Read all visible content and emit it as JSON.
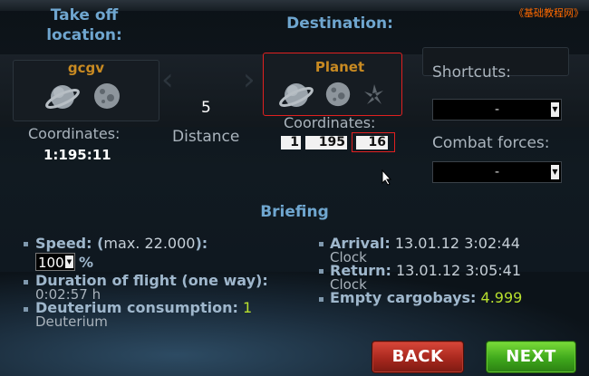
{
  "watermark": "《基础教程网》",
  "origin": {
    "heading_line1": "Take off",
    "heading_line2": "location:",
    "planet_name": "gcgv",
    "coords_label": "Coordinates:",
    "coords_value": "1:195:11"
  },
  "distance": {
    "value": "5",
    "label": "Distance"
  },
  "destination": {
    "heading": "Destination:",
    "planet_name": "Planet",
    "coords_label": "Coordinates:",
    "galaxy": "1",
    "system": "195",
    "position": "16"
  },
  "shortcuts": {
    "label": "Shortcuts:",
    "selected": "-"
  },
  "combat_forces": {
    "label": "Combat forces:",
    "selected": "-"
  },
  "briefing": {
    "heading": "Briefing",
    "speed_label": "Speed: (",
    "speed_max": "max. 22.000",
    "speed_label_end": "):",
    "speed_value": "100",
    "speed_unit": "%",
    "duration_label": "Duration of flight (one way):",
    "duration_value": "0:02:57 h",
    "deuterium_label": "Deuterium consumption:",
    "deuterium_value": "1",
    "deuterium_unit": "Deuterium",
    "arrival_label": "Arrival:",
    "arrival_value": "13.01.12 3:02:44",
    "arrival_unit": "Clock",
    "return_label": "Return:",
    "return_value": "13.01.12 3:05:41",
    "return_unit": "Clock",
    "cargo_label": "Empty cargobays:",
    "cargo_value": "4.999"
  },
  "buttons": {
    "back": "BACK",
    "next": "NEXT"
  },
  "colors": {
    "heading_blue": "#6fa6cf",
    "planet_orange": "#c88a22",
    "highlight_red": "#e02020",
    "cargo_green": "#b8e02e",
    "back_red": "#a8281e",
    "next_green": "#3fa81c"
  },
  "icons": [
    "planet-icon",
    "moon-icon",
    "debris-field-icon",
    "arrow-left-icon",
    "arrow-right-icon",
    "mouse-cursor-icon"
  ]
}
